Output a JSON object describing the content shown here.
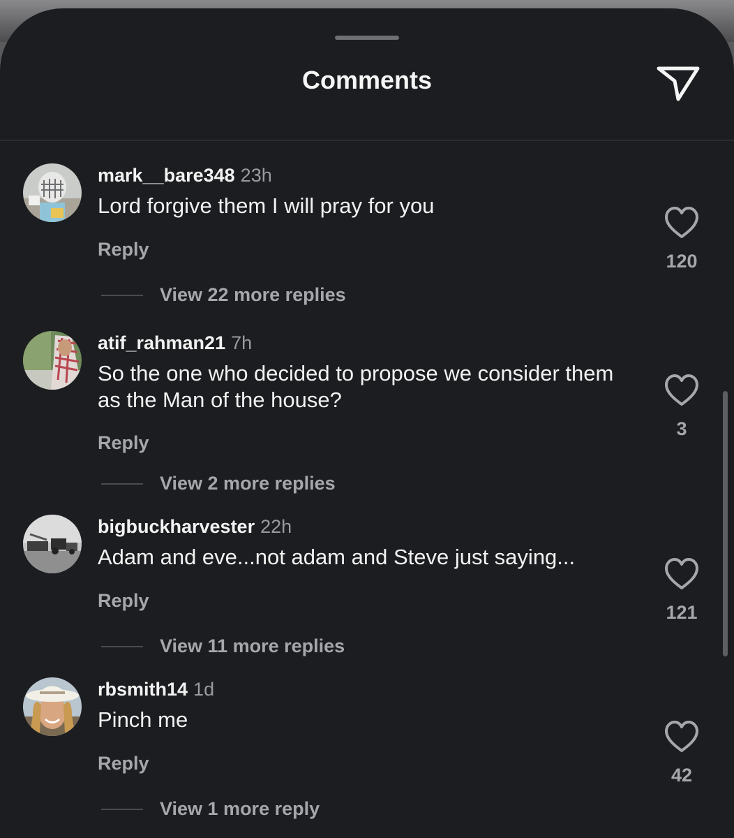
{
  "header": {
    "title": "Comments",
    "share_icon": "paper-plane-icon"
  },
  "comments": [
    {
      "username": "mark__bare348",
      "time": "23h",
      "text": "Lord forgive them I will pray for you",
      "reply_label": "Reply",
      "likes": "120",
      "view_replies": "View 22 more replies",
      "avatar_icon": "lacrosse-helmet-avatar"
    },
    {
      "username": "atif_rahman21",
      "time": "7h",
      "text": "So the one who decided to propose we consider them as the Man of the house?",
      "reply_label": "Reply",
      "likes": "3",
      "view_replies": "View 2 more replies",
      "avatar_icon": "keffiyeh-person-avatar"
    },
    {
      "username": "bigbuckharvester",
      "time": "22h",
      "text": "Adam and eve...not adam and Steve just saying...",
      "reply_label": "Reply",
      "likes": "121",
      "view_replies": "View 11 more replies",
      "avatar_icon": "harvester-avatar"
    },
    {
      "username": "rbsmith14",
      "time": "1d",
      "text": "Pinch me",
      "reply_label": "Reply",
      "likes": "42",
      "view_replies": "View 1 more reply",
      "avatar_icon": "cowboy-hat-person-avatar"
    }
  ],
  "colors": {
    "sheet_background": "#1c1d20",
    "primary_text": "#f2f2f2",
    "secondary_text": "#a6a7ab"
  }
}
